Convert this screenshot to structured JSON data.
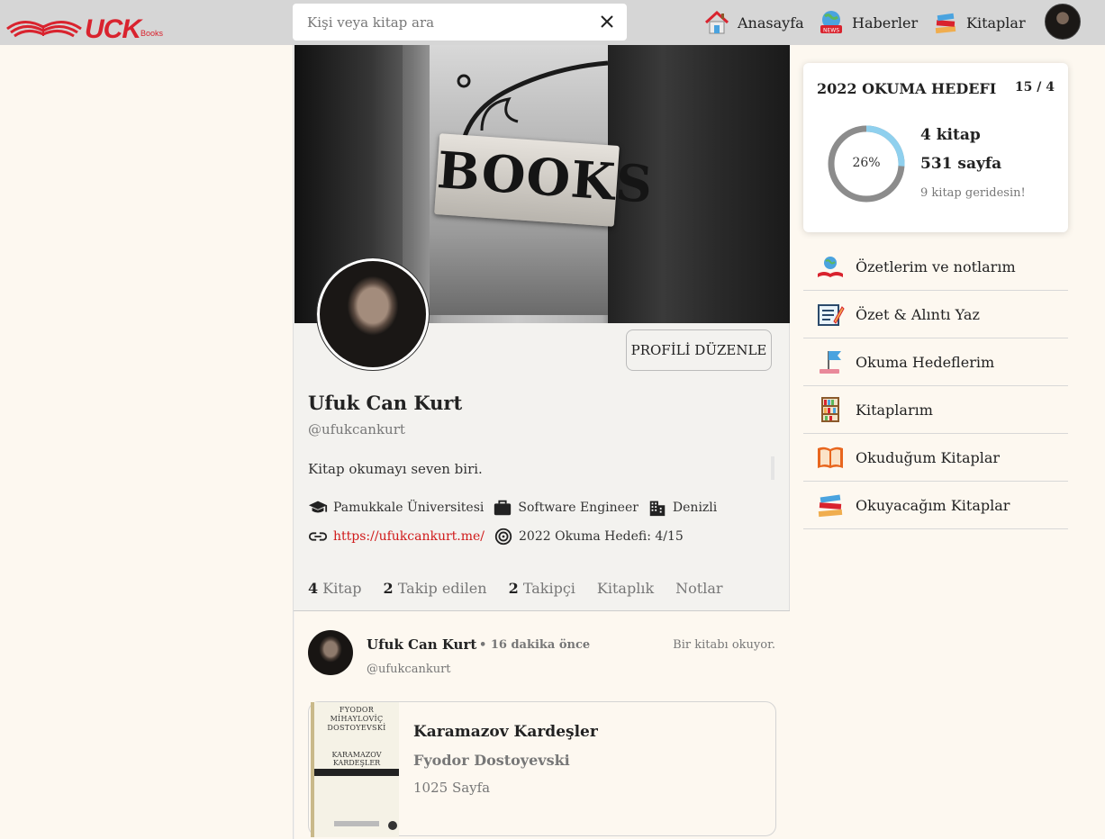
{
  "header": {
    "logo_text": "UCK",
    "logo_sub": "Books",
    "search_placeholder": "Kişi veya kitap ara",
    "nav": [
      {
        "label": "Anasayfa",
        "icon": "home-icon"
      },
      {
        "label": "Haberler",
        "icon": "news-icon"
      },
      {
        "label": "Kitaplar",
        "icon": "books-icon"
      }
    ]
  },
  "cover": {
    "sign_text": "BOOKS"
  },
  "profile": {
    "edit_label": "PROFİLİ DÜZENLE",
    "name": "Ufuk Can Kurt",
    "handle": "@ufukcankurt",
    "bio": "Kitap okumayı seven biri.",
    "school": "Pamukkale Üniversitesi",
    "job": "Software Engineer",
    "city": "Denizli",
    "website": "https://ufukcankurt.me/",
    "goal": "2022 Okuma Hedefi: 4/15"
  },
  "tabs": [
    {
      "count": "4",
      "label": "Kitap"
    },
    {
      "count": "2",
      "label": "Takip edilen"
    },
    {
      "count": "2",
      "label": "Takipçi"
    },
    {
      "count": "",
      "label": "Kitaplık"
    },
    {
      "count": "",
      "label": "Notlar"
    }
  ],
  "post": {
    "name": "Ufuk Can Kurt",
    "time": "• 16 dakika önce",
    "status": "Bir kitabı okuyor.",
    "handle": "@ufukcankurt",
    "book": {
      "title": "Karamazov Kardeşler",
      "author": "Fyodor Dostoyevski",
      "pages": "1025 Sayfa",
      "cover_author": "FYODOR MİHAYLOVİÇ DOSTOYEVSKİ",
      "cover_title": "KARAMAZOV KARDEŞLER"
    }
  },
  "reading_goal": {
    "title": "2022 OKUMA HEDEFI",
    "ratio": "15 / 4",
    "percent_label": "26%",
    "percent": 26,
    "books": "4 kitap",
    "pages": "531 sayfa",
    "behind": "9 kitap geridesin!",
    "colors": {
      "progress": "#8fd0ee",
      "track": "#8c8c8c"
    }
  },
  "menu": [
    {
      "label": "Özetlerim ve notlarım",
      "icon": "notes-icon"
    },
    {
      "label": "Özet & Alıntı Yaz",
      "icon": "write-icon"
    },
    {
      "label": "Okuma Hedeflerim",
      "icon": "flag-icon"
    },
    {
      "label": "Kitaplarım",
      "icon": "bookshelf-icon"
    },
    {
      "label": "Okuduğum Kitaplar",
      "icon": "open-book-icon"
    },
    {
      "label": "Okuyacağım Kitaplar",
      "icon": "book-stack-icon"
    }
  ],
  "brand_color": "#d9232e"
}
